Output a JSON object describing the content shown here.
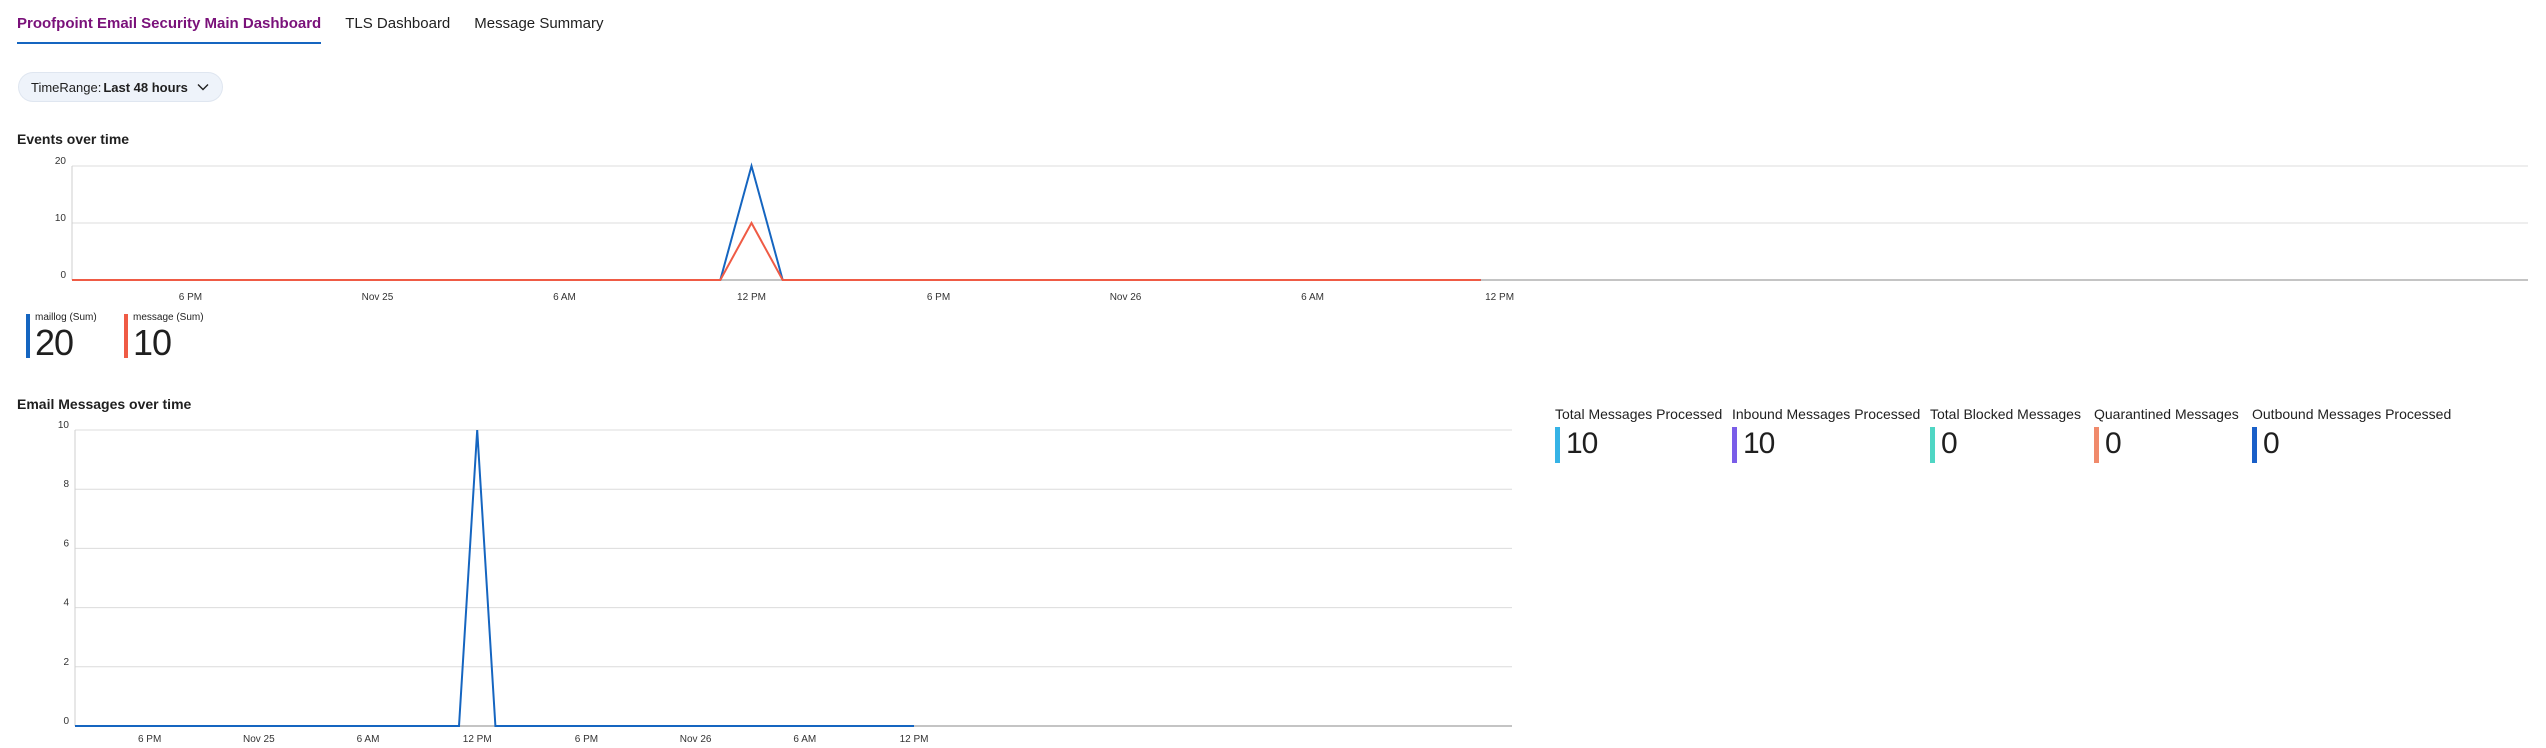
{
  "tabs": [
    {
      "label": "Proofpoint Email Security Main Dashboard",
      "active": true
    },
    {
      "label": "TLS Dashboard",
      "active": false
    },
    {
      "label": "Message Summary",
      "active": false
    }
  ],
  "time_range": {
    "label": "TimeRange:",
    "value": "Last 48 hours"
  },
  "events_chart": {
    "title": "Events over time",
    "legend": [
      {
        "name": "maillog (Sum)",
        "value": "20",
        "color": "#1565c0"
      },
      {
        "name": "message (Sum)",
        "value": "10",
        "color": "#ef5b45"
      }
    ]
  },
  "email_chart": {
    "title": "Email Messages over time"
  },
  "kpis": [
    {
      "label": "Total Messages Processed",
      "value": "10",
      "color": "#36b3e6"
    },
    {
      "label": "Inbound Messages Processed",
      "value": "10",
      "color": "#7a5de8"
    },
    {
      "label": "Total Blocked Messages",
      "value": "0",
      "color": "#4fd6c4"
    },
    {
      "label": "Quarantined Messages",
      "value": "0",
      "color": "#f08a6b"
    },
    {
      "label": "Outbound Messages Processed",
      "value": "0",
      "color": "#1a5fc8"
    }
  ],
  "chart_data": [
    {
      "type": "line",
      "title": "Events over time",
      "x": [
        "Nov 24 12 PM",
        "Nov 24 6 PM",
        "Nov 25 12 AM",
        "Nov 25 6 AM",
        "Nov 25 11 AM",
        "Nov 25 12 PM",
        "Nov 25 1 PM",
        "Nov 25 6 PM",
        "Nov 26 12 AM",
        "Nov 26 6 AM",
        "Nov 26 12 PM"
      ],
      "x_ticks": [
        "6 PM",
        "Nov 25",
        "6 AM",
        "12 PM",
        "6 PM",
        "Nov 26",
        "6 AM",
        "12 PM"
      ],
      "ylim": [
        0,
        20
      ],
      "y_ticks": [
        "0",
        "10",
        "20"
      ],
      "grid": true,
      "series": [
        {
          "name": "maillog (Sum)",
          "color": "#1565c0",
          "values": [
            0,
            0,
            0,
            0,
            0,
            20,
            0,
            0,
            0,
            0,
            0
          ]
        },
        {
          "name": "message (Sum)",
          "color": "#ef5b45",
          "values": [
            0,
            0,
            0,
            0,
            0,
            10,
            0,
            0,
            0,
            0,
            0
          ]
        }
      ]
    },
    {
      "type": "line",
      "title": "Email Messages over time",
      "x": [
        "Nov 24 12 PM",
        "Nov 24 6 PM",
        "Nov 25 12 AM",
        "Nov 25 6 AM",
        "Nov 25 11 AM",
        "Nov 25 12 PM",
        "Nov 25 1 PM",
        "Nov 25 6 PM",
        "Nov 26 12 AM",
        "Nov 26 6 AM",
        "Nov 26 12 PM"
      ],
      "x_ticks": [
        "6 PM",
        "Nov 25",
        "6 AM",
        "12 PM",
        "6 PM",
        "Nov 26",
        "6 AM",
        "12 PM"
      ],
      "ylim": [
        0,
        10
      ],
      "y_ticks": [
        "0",
        "2",
        "4",
        "6",
        "8",
        "10"
      ],
      "grid": true,
      "series": [
        {
          "color": "#1565c0",
          "values": [
            0,
            0,
            0,
            0,
            0,
            10,
            0,
            0,
            0,
            0,
            0
          ]
        }
      ]
    }
  ]
}
